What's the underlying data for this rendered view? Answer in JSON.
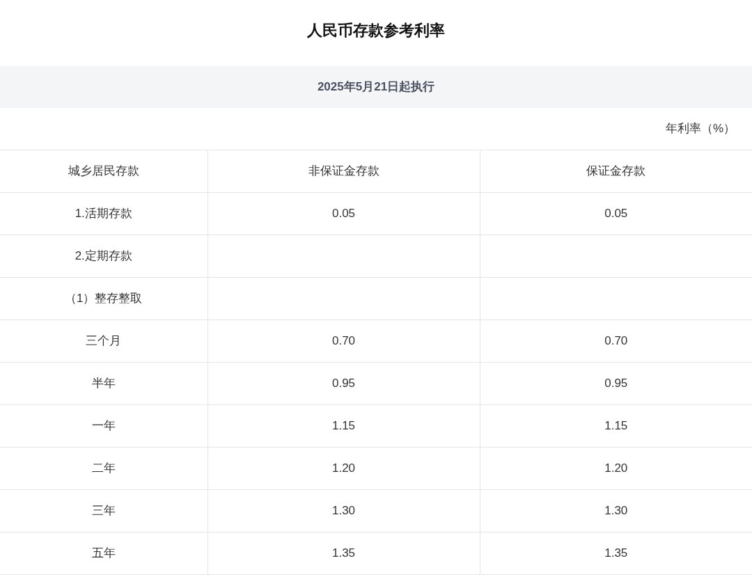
{
  "title": "人民币存款参考利率",
  "effective_date": "2025年5月21日起执行",
  "unit_note": "年利率（%）",
  "table": {
    "columns": [
      "城乡居民存款",
      "非保证金存款",
      "保证金存款"
    ],
    "rows": [
      [
        "1.活期存款",
        "0.05",
        "0.05"
      ],
      [
        "2.定期存款",
        "",
        ""
      ],
      [
        "（1）整存整取",
        "",
        ""
      ],
      [
        "三个月",
        "0.70",
        "0.70"
      ],
      [
        "半年",
        "0.95",
        "0.95"
      ],
      [
        "一年",
        "1.15",
        "1.15"
      ],
      [
        "二年",
        "1.20",
        "1.20"
      ],
      [
        "三年",
        "1.30",
        "1.30"
      ],
      [
        "五年",
        "1.35",
        "1.35"
      ]
    ]
  }
}
